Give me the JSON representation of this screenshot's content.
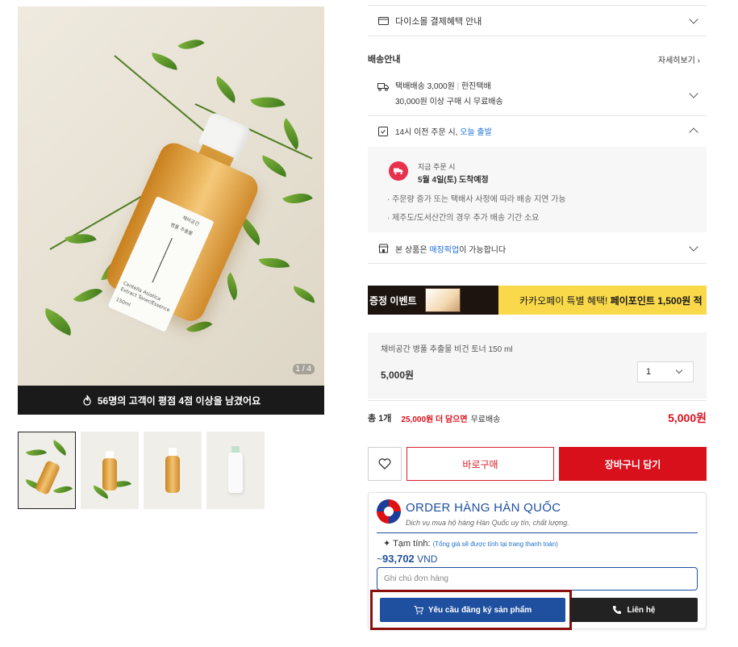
{
  "gallery": {
    "counter": "1 / 4",
    "review_banner": "56명의 고객이 평점 4점 이상을 남겼어요",
    "bottle_label_brand": "채비공간",
    "bottle_label_name": "병풀 추출물",
    "bottle_label_en": "Centella Asiatica Extract Toner/Essence",
    "bottle_label_size": "150ml",
    "thumbnails": 4
  },
  "payment": {
    "label": "다이소몰 결제혜택 안내"
  },
  "delivery": {
    "section_title": "배송안내",
    "more_link": "자세히보기",
    "courier_fee": "택배배송 3,000원",
    "courier_name": "한진택배",
    "free_shipping": "30,000원 이상 구매 시 무료배송",
    "same_day_prefix": "14시 이전 주문 시,",
    "same_day_highlight": "오늘 출발",
    "order_now": "지금 주문 시",
    "eta": "5월 4일(토) 도착예정",
    "notice_1": "주문량 증가 또는 택배사 사정에 따라 배송 지연 가능",
    "notice_2": "제주도/도서산간의 경우 추가 배송 기간 소요",
    "pickup_prefix": "본 상품은",
    "pickup_highlight": "매장픽업",
    "pickup_suffix": "이 가능합니다"
  },
  "promo": {
    "left_text": "증정 이벤트",
    "right_prefix": "카카오페이 특별 혜택!",
    "right_bold": "페이포인트 1,500원 적"
  },
  "option": {
    "name": "채비공간 병풀 추출물 비건 토너 150 ml",
    "price": "5,000원",
    "qty": "1"
  },
  "summary": {
    "count_label": "총 1개",
    "remaining": "25,000원 더 담으면",
    "free_label": "무료배송",
    "total": "5,000원"
  },
  "actions": {
    "buy_now": "바로구매",
    "add_cart": "장바구니 담기"
  },
  "order_widget": {
    "title": "ORDER HÀNG HÀN QUỐC",
    "subtitle": "Dịch vụ mua hộ hàng Hàn Quốc uy tín, chất lượng.",
    "subtotal_label": "Tạm tính:",
    "subtotal_note": "(Tổng giá sẽ được tính tại trang thanh toán)",
    "price_prefix": "~",
    "price_value": "93,702",
    "currency": "VND",
    "note_placeholder": "Ghi chú đơn hàng",
    "request_button": "Yêu cầu đăng ký sản phẩm",
    "contact_button": "Liên hệ"
  },
  "colors": {
    "brand_red": "#d8101c",
    "widget_blue": "#1f4f9f",
    "link_blue": "#1a6fd8",
    "promo_yellow": "#f9d94a"
  }
}
